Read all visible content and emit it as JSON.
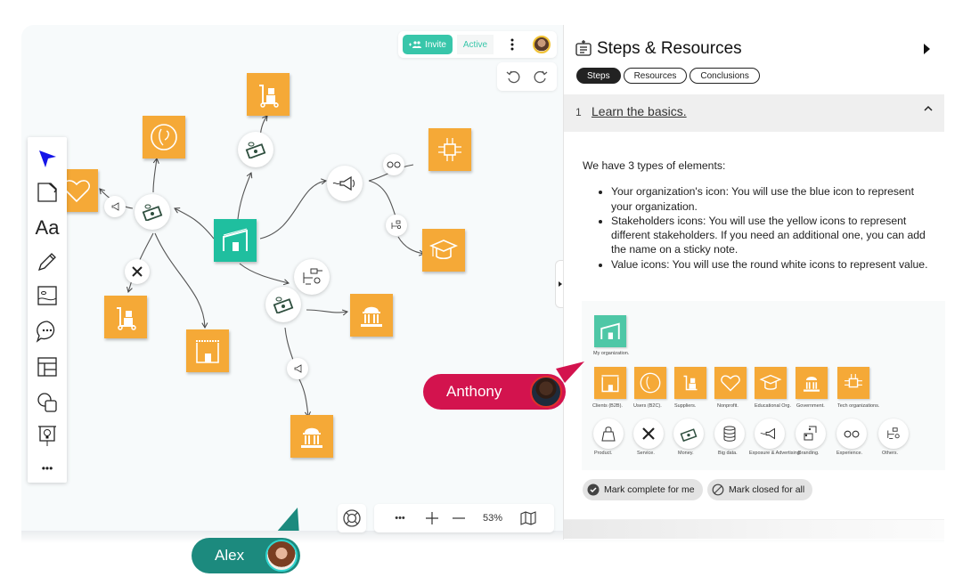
{
  "topbar": {
    "invite_label": "Invite",
    "active_label": "Active"
  },
  "toolbar": {
    "tools": [
      {
        "name": "select"
      },
      {
        "name": "sticky-note"
      },
      {
        "name": "text",
        "glyph": "Aa"
      },
      {
        "name": "pen"
      },
      {
        "name": "image"
      },
      {
        "name": "comment"
      },
      {
        "name": "template"
      },
      {
        "name": "shapes"
      },
      {
        "name": "presentation"
      },
      {
        "name": "more",
        "glyph": "•••"
      }
    ]
  },
  "zoombar": {
    "more": "•••",
    "zoom_level": "53%"
  },
  "cursors": {
    "anthony": "Anthony",
    "alex": "Alex"
  },
  "colors": {
    "stakeholder": "#f5a937",
    "organization": "#1fbf9f",
    "anthony": "#d3134e",
    "alex": "#1c8a7e",
    "invite": "#38c6aa"
  },
  "panel": {
    "title": "Steps & Resources",
    "tabs": [
      "Steps",
      "Resources",
      "Conclusions"
    ],
    "selected_tab": "Steps",
    "step": {
      "number": "1",
      "title": "Learn the basics."
    },
    "intro": "We have 3 types of elements:",
    "bullets": [
      {
        "bold": "Your organization's icon:",
        "text": " You will use the blue icon to represent your organization."
      },
      {
        "bold": "Stakeholders icons:",
        "text": " You will use the yellow icons to represent different stakeholders. If you need an additional one, you can add the name on a sticky note."
      },
      {
        "bold": "Value icons:",
        "text": " You will use the round white icons to represent value."
      }
    ],
    "legend": {
      "organization": "My organization.",
      "stakeholders": [
        "Clients (B2B).",
        "Users (B2C).",
        "Suppliers.",
        "Nonprofit.",
        "Educational Org.",
        "Government.",
        "Tech organizations."
      ],
      "values": [
        "Product.",
        "Service.",
        "Money.",
        "Big data.",
        "Exposure & Advertising.",
        "Branding.",
        "Experience.",
        "Others."
      ]
    },
    "buttons": {
      "complete": "Mark complete for me",
      "close": "Mark closed for all"
    }
  }
}
